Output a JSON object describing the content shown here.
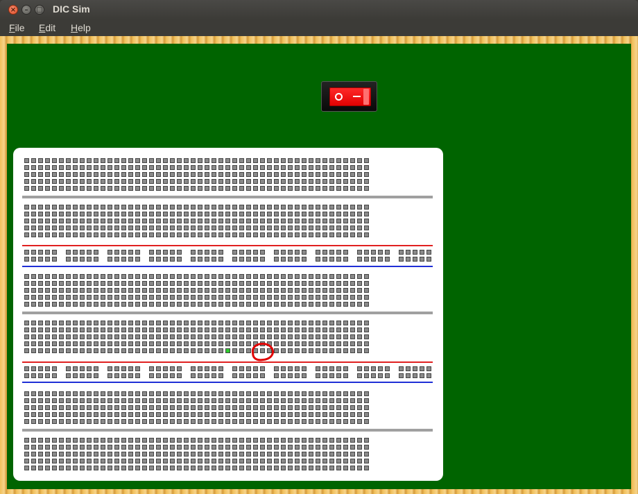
{
  "window": {
    "title": "DIC Sim",
    "close_glyph": "×",
    "minimize_glyph": "–",
    "maximize_glyph": "□"
  },
  "menu": [
    {
      "label": "File",
      "mnemonic": "F",
      "rest": "ile"
    },
    {
      "label": "Edit",
      "mnemonic": "E",
      "rest": "dit"
    },
    {
      "label": "Help",
      "mnemonic": "H",
      "rest": "elp"
    }
  ],
  "power_switch": {
    "state": "off",
    "off_symbol": "O",
    "on_symbol": "–",
    "color": "#ff0000"
  },
  "breadboard": {
    "columns": 50,
    "terminal_strips": 4,
    "rows_per_strip": 10,
    "power_rails": 2,
    "rail_groups": 10,
    "rail_holes_per_group": 5,
    "highlighted_hole": {
      "strip": 2,
      "row": 4,
      "column": 29
    },
    "colors": {
      "hole": "#8a8a8a",
      "lit_hole": "#2ecc2e",
      "divider": "#a0a0a0",
      "rail_positive": "#e02020",
      "rail_negative": "#1f2fd6",
      "board_green": "#006400",
      "highlight": "#e00000"
    }
  }
}
